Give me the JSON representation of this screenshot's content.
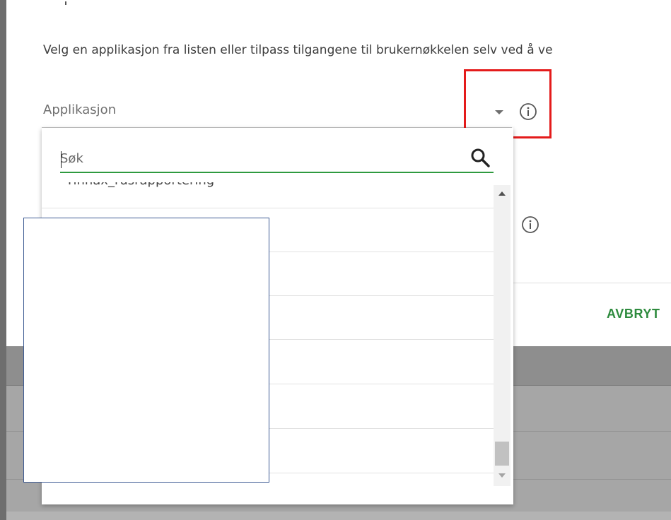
{
  "dialog": {
    "intro_text": "Velg en applikasjon fra listen eller tilpass tilgangene til brukernøkkelen selv ved å ve",
    "application_field": {
      "label": "Applikasjon",
      "dropdown_icon": "chevron-down-icon",
      "info_icon": "info-icon"
    },
    "second_info_icon": "info-icon",
    "cancel_button_label": "AVBRYT",
    "accent_color": "#2e8b3e",
    "highlight_color": "#e41b1b"
  },
  "dropdown": {
    "search": {
      "placeholder": "Søk",
      "icon": "search-icon"
    },
    "items": [
      {
        "label": "Tinnax_rusrapportering"
      },
      {
        "label": ""
      },
      {
        "label": ""
      },
      {
        "label": ""
      },
      {
        "label": ""
      },
      {
        "label": ""
      },
      {
        "label": ""
      }
    ]
  }
}
